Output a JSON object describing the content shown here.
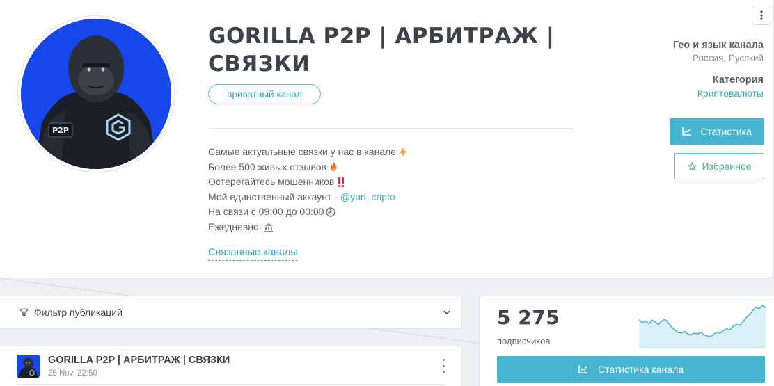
{
  "channel": {
    "title": "GORILLA P2P | АРБИТРАЖ | СВЯЗКИ",
    "badge": "приватный канал",
    "avatar_logo_text": "P2P",
    "description": [
      {
        "text": "Самые актуальные связки у нас в канале",
        "emoji": "lightning-icon"
      },
      {
        "text": "Более 500 живых отзывов",
        "emoji": "fire-icon"
      },
      {
        "text": "Остерегайтесь мошенников",
        "emoji": "double-exclamation-icon"
      },
      {
        "text": "Мой единственный аккаунт -",
        "link": "@yuri_cripto"
      },
      {
        "text": "На связи с 09:00 до 00:00",
        "emoji": "clock-icon"
      },
      {
        "text": "Ежедневно.",
        "emoji": "bank-icon"
      }
    ],
    "related_link": "Связанные каналы"
  },
  "meta": {
    "geo_title": "Гео и язык канала",
    "geo_value": "Россия, Русский",
    "category_title": "Категория",
    "category_value": "Криптовалюты"
  },
  "actions": {
    "stats_label": "Статистика",
    "favorite_label": "Избранное"
  },
  "filter": {
    "label": "Фильтр публикаций"
  },
  "post": {
    "channel_name": "GORILLA P2P | АРБИТРАЖ | СВЯЗКИ",
    "date": "25 Nov, 22:50"
  },
  "stats": {
    "subscribers": "5 275",
    "subscribers_label": "подписчиков",
    "button_label": "Статистика канала",
    "sparkline": [
      42,
      38,
      40,
      37,
      41,
      39,
      36,
      40,
      42,
      38,
      33,
      30,
      27,
      26,
      28,
      25,
      24,
      26,
      25,
      27,
      24,
      23,
      22,
      25,
      27,
      26,
      29,
      31,
      30,
      34,
      36,
      35,
      39,
      44,
      47,
      52,
      56,
      54,
      58,
      55
    ],
    "colors": {
      "accent": "#48b5d0",
      "fill": "#d9f0f7",
      "line": "#48b5d0"
    }
  }
}
